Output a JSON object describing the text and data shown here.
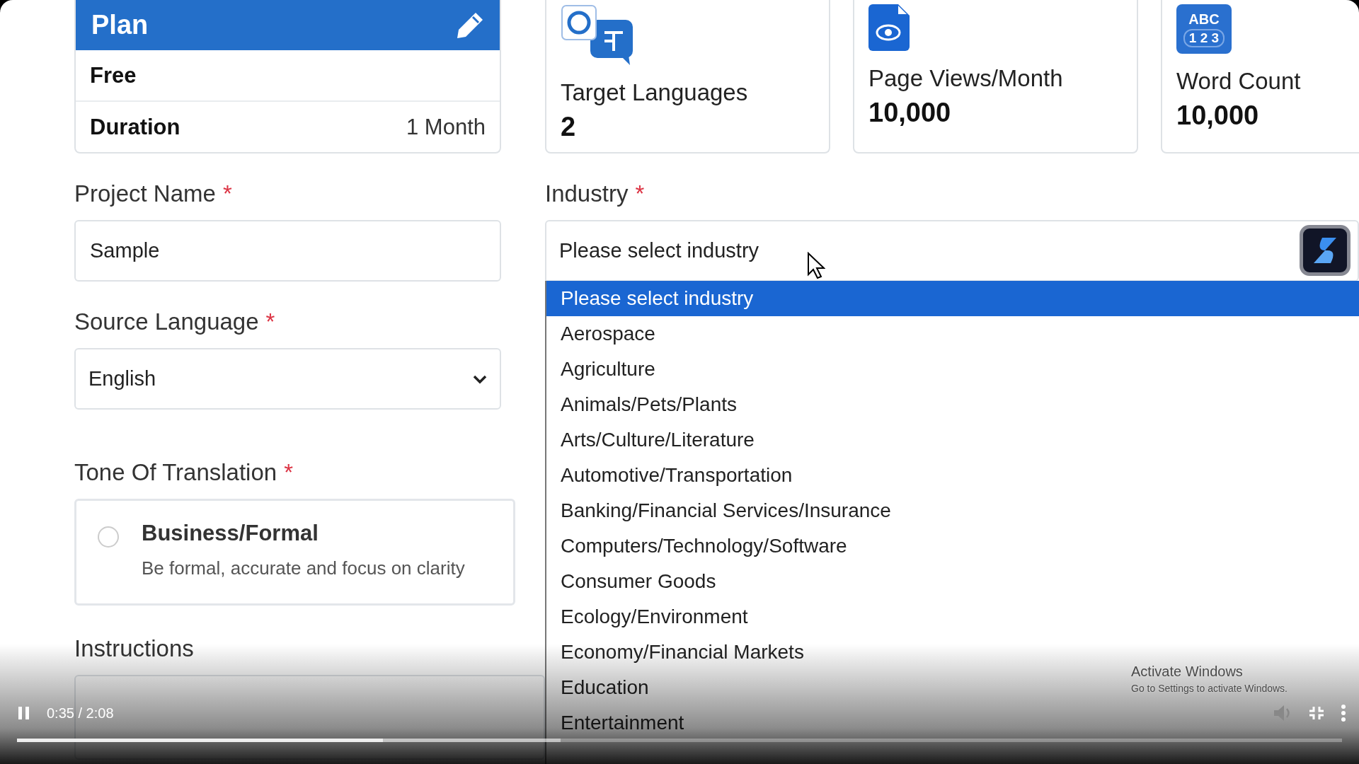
{
  "plan": {
    "title": "Plan",
    "tier": "Free",
    "duration_label": "Duration",
    "duration_value": "1 Month"
  },
  "stats": [
    {
      "kind": "languages",
      "label": "Target Languages",
      "value": "2"
    },
    {
      "kind": "views",
      "label": "Page Views/Month",
      "value": "10,000"
    },
    {
      "kind": "words",
      "label": "Word Count",
      "value": "10,000",
      "icon_top": "ABC",
      "icon_bottom": "1 2 3"
    }
  ],
  "project_name": {
    "label": "Project Name",
    "required_mark": "*",
    "value": "Sample"
  },
  "industry": {
    "label": "Industry",
    "required_mark": "*",
    "value": "Please select industry",
    "expanded": true
  },
  "source_language": {
    "label": "Source Language",
    "required_mark": "*",
    "value": "English"
  },
  "tone": {
    "label": "Tone Of Translation",
    "required_mark": "*",
    "options": [
      {
        "title": "Business/Formal",
        "description": "Be formal, accurate and focus on clarity",
        "selected": false
      }
    ]
  },
  "instructions": {
    "label": "Instructions"
  },
  "industry_options": [
    {
      "label": "Please select industry",
      "selected": true
    },
    {
      "label": "Aerospace",
      "selected": false
    },
    {
      "label": "Agriculture",
      "selected": false
    },
    {
      "label": "Animals/Pets/Plants",
      "selected": false
    },
    {
      "label": "Arts/Culture/Literature",
      "selected": false
    },
    {
      "label": "Automotive/Transportation",
      "selected": false
    },
    {
      "label": "Banking/Financial Services/Insurance",
      "selected": false
    },
    {
      "label": "Computers/Technology/Software",
      "selected": false
    },
    {
      "label": "Consumer Goods",
      "selected": false
    },
    {
      "label": "Ecology/Environment",
      "selected": false
    },
    {
      "label": "Economy/Financial Markets",
      "selected": false
    },
    {
      "label": "Education",
      "selected": false
    },
    {
      "label": "Entertainment",
      "selected": false
    }
  ],
  "os_notice": {
    "title": "Activate Windows",
    "subtitle": "Go to Settings to activate Windows."
  },
  "player": {
    "playing": true,
    "time": "0:35 / 2:08",
    "progress": {
      "level": 0.276
    }
  }
}
